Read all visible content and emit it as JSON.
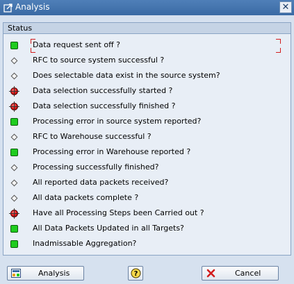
{
  "window": {
    "title": "Analysis",
    "close_glyph": "✕"
  },
  "panel": {
    "header": "Status"
  },
  "status_colors": {
    "green": "#1fcc1f",
    "red": "#e21313",
    "gray": "#f4f4f4"
  },
  "rows": [
    {
      "label": "Data request sent off ?",
      "status": "green"
    },
    {
      "label": "RFC to source system successful ?",
      "status": "gray"
    },
    {
      "label": "Does selectable data exist in the source system?",
      "status": "gray"
    },
    {
      "label": "Data selection successfully started ?",
      "status": "red"
    },
    {
      "label": "Data selection successfully finished ?",
      "status": "red"
    },
    {
      "label": "Processing error in source system reported?",
      "status": "green"
    },
    {
      "label": "RFC to Warehouse successful ?",
      "status": "gray"
    },
    {
      "label": "Processing error in Warehouse reported ?",
      "status": "green"
    },
    {
      "label": "Processing successfully finished?",
      "status": "gray"
    },
    {
      "label": "All reported data packets received?",
      "status": "gray"
    },
    {
      "label": "All data packets complete ?",
      "status": "gray"
    },
    {
      "label": "Have all Processing Steps been Carried out ?",
      "status": "red"
    },
    {
      "label": "All Data Packets Updated in all Targets?",
      "status": "green"
    },
    {
      "label": "Inadmissable Aggregation?",
      "status": "green"
    }
  ],
  "buttons": {
    "analysis_label": "Analysis",
    "help_label": "?",
    "cancel_label": "Cancel"
  }
}
